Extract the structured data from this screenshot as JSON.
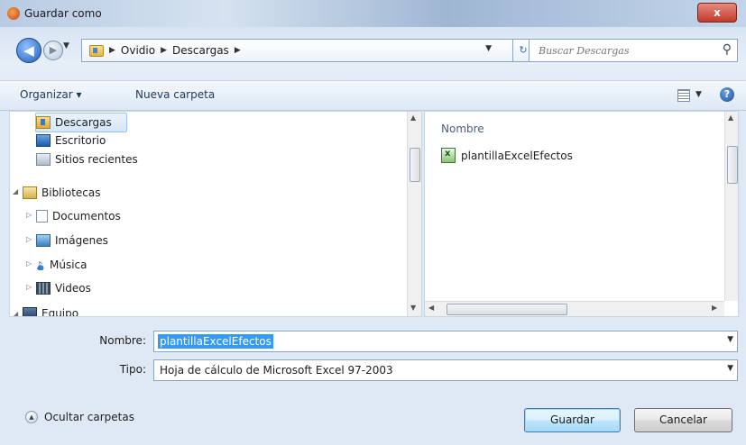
{
  "window": {
    "title": "Guardar como",
    "close_label": "x"
  },
  "address": {
    "crumbs": [
      "Ovidio",
      "Descargas"
    ],
    "search_placeholder": "Buscar Descargas"
  },
  "toolbar": {
    "organize_label": "Organizar ▾",
    "new_folder_label": "Nueva carpeta"
  },
  "nav_pane": {
    "items": [
      {
        "label": "Descargas",
        "icon": "downloads-folder-icon",
        "selected": true
      },
      {
        "label": "Escritorio",
        "icon": "desktop-icon"
      },
      {
        "label": "Sitios recientes",
        "icon": "recent-places-icon"
      },
      {
        "label": "Bibliotecas",
        "icon": "libraries-icon"
      },
      {
        "label": "Documentos",
        "icon": "documents-icon"
      },
      {
        "label": "Imágenes",
        "icon": "pictures-icon"
      },
      {
        "label": "Música",
        "icon": "music-icon"
      },
      {
        "label": "Videos",
        "icon": "videos-icon"
      },
      {
        "label": "Equipo",
        "icon": "computer-icon"
      }
    ]
  },
  "file_pane": {
    "column_header": "Nombre",
    "files": [
      {
        "name": "plantillaExcelEfectos",
        "icon": "excel-file-icon"
      }
    ]
  },
  "form": {
    "filename_label": "Nombre:",
    "filename_value": "plantillaExcelEfectos",
    "type_label": "Tipo:",
    "type_value": "Hoja de cálculo de Microsoft Excel 97-2003"
  },
  "footer": {
    "hide_folders_label": "Ocultar carpetas",
    "save_label": "Guardar",
    "cancel_label": "Cancelar"
  },
  "colors": {
    "selection": "#3399ff",
    "window_frame": "#c9dbef",
    "primary_button": "#bee6fd"
  }
}
